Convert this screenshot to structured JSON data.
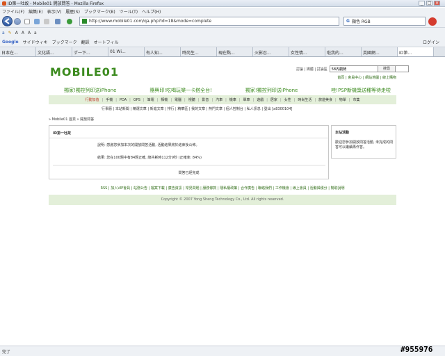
{
  "window": {
    "title": "ID第一吐故 - Mobile01 開放問答 - Mozilla Firefox"
  },
  "menubar": {
    "items": [
      "ファイル(F)",
      "編集(E)",
      "表示(V)",
      "履歴(S)",
      "ブックマーク(B)",
      "ツール(T)",
      "ヘルプ(H)"
    ]
  },
  "navbar": {
    "url": "http://www.mobile01.com/qa.php?id=18&mode=complete",
    "search_value": "顏色 RGB"
  },
  "bookmarks": {
    "items": [
      "サイドウィキ",
      "ブックマーク",
      "翻訳",
      "オートフィル"
    ],
    "login": "ログイン"
  },
  "tabs": [
    {
      "label": "日本在..."
    },
    {
      "label": "文化語..."
    },
    {
      "label": "ず一下..."
    },
    {
      "label": "01 Wi..."
    },
    {
      "label": "有人知..."
    },
    {
      "label": "時尚生..."
    },
    {
      "label": "現在點..."
    },
    {
      "label": "火影忍..."
    },
    {
      "label": "女性情..."
    },
    {
      "label": "啦我的..."
    },
    {
      "label": "英國網..."
    },
    {
      "label": "ID第..."
    }
  ],
  "site": {
    "logo": "MOBILE01",
    "search_links": "討論 | 媒體 | 討論區",
    "search_value": "58內觀騎",
    "search_button": "搜尋",
    "top_links": "首頁 | 會員中心 | 網站地圖 | 線上購物",
    "ads": [
      "獨家!獨控列印送iPhone",
      "隨興印!吃喝玩樂一卡搭全台!",
      "獨家!獨控列印送iPhone",
      "哇!PSP新機獎送種等待走啦"
    ],
    "categories": [
      "行動加值",
      "手機",
      "PDA",
      "GPS",
      "筆電",
      "相機",
      "電腦",
      "視聽",
      "影音",
      "汽車",
      "機車",
      "單車",
      "遊戲",
      "居家",
      "女性",
      "時尚生活",
      "旅遊美食",
      "物單",
      "市集"
    ],
    "subnav": "行事曆 | 本站新聞 | 精選文章 | 新進文章 | 排行 | 精華區 | 我的文章 | 熱門文章 | 個人控制台 | 私人訊息 | 登出 [a8300104]",
    "breadcrumb": "» Mobile01 首頁 » 開放問答"
  },
  "main": {
    "heading": "ID第一吐故",
    "description": "說明: 感謝您參加本次的開放問答活動, 活動結果將於結束後公佈。",
    "result": "結果: 您在100題中有84題正確, 總共耗時112分9秒 (正確率: 84%)",
    "done": "問答已經完成"
  },
  "side": {
    "heading": "本站活動",
    "body": "歡迎您參加開放問答活動, 未完成的問答可以繼續再作答。"
  },
  "footer": {
    "links": "RSS | 加入VIP會員 | 站務公告 | 檔案下載 | 廣告資訊 | 常見問題 | 服務條款 | 隱私權政策 | 合作廣告 | 聯絡我們 | 工作機會 | 線上會員 | 活動與積分 | 幫助說明",
    "copyright": "Copyright © 2007 Yong Sheng Technology Co., Ltd. All rights reserved."
  },
  "status": {
    "text": "完了"
  },
  "watermark": "#955976"
}
